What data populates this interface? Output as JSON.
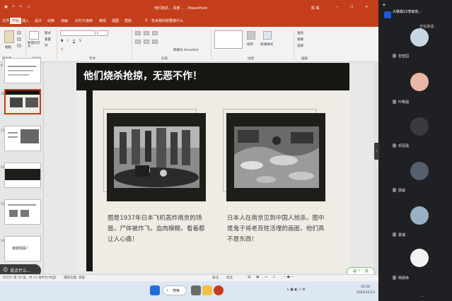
{
  "window": {
    "title": "他们烧杀... 百度 ... - PowerPoint",
    "user": "陈 陈",
    "menu_tabs": [
      "文件",
      "开始",
      "插入",
      "设计",
      "切换",
      "动画",
      "幻灯片放映",
      "审阅",
      "视图",
      "帮助",
      "告诉我你想要做什么"
    ]
  },
  "ribbon": {
    "groups": [
      "剪贴板",
      "幻灯片",
      "字体",
      "段落",
      "绘图",
      "编辑"
    ],
    "items": {
      "paste": "粘贴",
      "new_slide": "新建幻灯片",
      "layout": "版式",
      "reset": "重置",
      "section": "节",
      "arrange": "排列",
      "quick_styles": "快速样式",
      "find": "查找",
      "replace": "替换",
      "select": "选择",
      "convert_smartart": "转换为 SmartArt"
    }
  },
  "thumbnails": [
    {
      "num": "9"
    },
    {
      "num": "10"
    },
    {
      "num": "11"
    },
    {
      "num": "12"
    },
    {
      "num": "13"
    },
    {
      "num": "14",
      "text": "谢谢观看！"
    }
  ],
  "slide": {
    "title": "他们烧杀抢掠，无恶不作！",
    "left_caption": "图是1937年日本飞机轰炸南京的场面，尸体被炸飞，血肉模糊，看着都让人心痛！",
    "right_caption": "日本人在南京见到中国人就杀，图中是鬼子将老百姓活埋的画面，他们真不是东西！"
  },
  "statusbar": {
    "slide_pos": "幻灯片 第 10 张，共 13 张",
    "language": "中文(中国)",
    "accessibility": "辅助功能: 调查",
    "notes": "备注",
    "comments": "批注"
  },
  "chat_pill": {
    "label": "说点什么..."
  },
  "ime": {
    "label": "中 \" ‘ 半"
  },
  "taskbar": {
    "search": "搜索",
    "time": "20:58",
    "date": "2022/12/13"
  },
  "meeting": {
    "header": "大致做22李雨佳...",
    "status": "正在讲话：",
    "participants": [
      {
        "name": "张智园",
        "color": "#c9d6e3"
      },
      {
        "name": "叶畅涵",
        "color": "#e9b7a6"
      },
      {
        "name": "邓冠语",
        "color": "#3b3a3f"
      },
      {
        "name": "顾威",
        "color": "#56606c"
      },
      {
        "name": "夏瑞",
        "color": "#9ab0c4"
      },
      {
        "name": "杨朋铮",
        "color": "#f2f2f2"
      }
    ]
  }
}
